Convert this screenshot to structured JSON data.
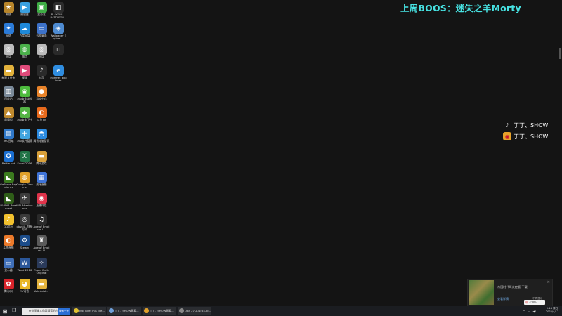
{
  "stream": {
    "title": "上周BOOS：迷失之羊Morty",
    "title_color": "#47e3e3",
    "socials": [
      {
        "icon": "tiktok-icon",
        "label": "丁丁、SHOW"
      },
      {
        "icon": "weibo-icon",
        "label": "丁丁、SHOW"
      }
    ]
  },
  "desktop_icons": [
    {
      "label": "系统",
      "icon": "logo-icon",
      "color": "#b8862b"
    },
    {
      "label": "播放器",
      "icon": "play-icon",
      "color": "#3aa0e0"
    },
    {
      "label": "爱奇艺",
      "icon": "video-icon",
      "color": "#3fae46"
    },
    {
      "label": "PLAYERU... BATTLEGR...",
      "icon": "game-icon",
      "color": "#2c2c2c"
    },
    {
      "label": "网络",
      "icon": "bird-icon",
      "color": "#2b7bd8"
    },
    {
      "label": "百度网盘",
      "icon": "cloud-icon",
      "color": "#1e88d8"
    },
    {
      "label": "远程桌面",
      "icon": "monitor-icon",
      "color": "#3d72c9"
    },
    {
      "label": "Wallpaper Engine: ...",
      "icon": "wallpaper-icon",
      "color": "#4e8bd1"
    },
    {
      "label": "光盘",
      "icon": "disc-icon",
      "color": "#bbbbbb"
    },
    {
      "label": "微信",
      "icon": "wechat-icon",
      "color": "#4ab04a"
    },
    {
      "label": "光盘",
      "icon": "disc-icon",
      "color": "#bbbbbb"
    },
    {
      "label": "",
      "icon": "file-icon",
      "color": "#2a2a2a"
    },
    {
      "label": "新建文件夹",
      "icon": "folder-icon",
      "color": "#e3b23c"
    },
    {
      "label": "视频",
      "icon": "media-icon",
      "color": "#e04a7a"
    },
    {
      "label": "抖音",
      "icon": "music-icon",
      "color": "#2a2a2a"
    },
    {
      "label": "Internet Explorer",
      "icon": "ie-icon",
      "color": "#2f8de0"
    },
    {
      "label": "回收站",
      "icon": "bin-icon",
      "color": "#7a8a99"
    },
    {
      "label": "360安全浏览器",
      "icon": "browser-icon",
      "color": "#4dbb3d"
    },
    {
      "label": "游戏中心",
      "icon": "circle-icon",
      "color": "#e8832a"
    },
    {
      "label": "",
      "icon": "",
      "color": ""
    },
    {
      "label": "屏幕锁",
      "icon": "lock-icon",
      "color": "#c08a2e"
    },
    {
      "label": "360安全卫士",
      "icon": "shield-icon",
      "color": "#55b545"
    },
    {
      "label": "斗鱼TV",
      "icon": "fish-icon",
      "color": "#e86a1c"
    },
    {
      "label": "",
      "icon": "",
      "color": ""
    },
    {
      "label": "360压缩",
      "icon": "zip-icon",
      "color": "#2f78c9"
    },
    {
      "label": "360软件管家",
      "icon": "apps-icon",
      "color": "#41a5e0"
    },
    {
      "label": "腾讯电脑管家",
      "icon": "guard-icon",
      "color": "#2a8ae0"
    },
    {
      "label": "",
      "icon": "",
      "color": ""
    },
    {
      "label": "Battle.net",
      "icon": "battlenet-icon",
      "color": "#1a6ed0"
    },
    {
      "label": "Excel 2016",
      "icon": "excel-icon",
      "color": "#217346"
    },
    {
      "label": "腾讯游戏",
      "icon": "folder-icon",
      "color": "#d8a03a"
    },
    {
      "label": "",
      "icon": "",
      "color": ""
    },
    {
      "label": "GeForce Experience",
      "icon": "nvidia-icon",
      "color": "#3b7a1e"
    },
    {
      "label": "Google Chrome",
      "icon": "chrome-icon",
      "color": "#e0a02a"
    },
    {
      "label": "虎牙直播",
      "icon": "tv-icon",
      "color": "#3f74d8"
    },
    {
      "label": "",
      "icon": "",
      "color": ""
    },
    {
      "label": "NVIDIA Broadcast",
      "icon": "nvidia-icon",
      "color": "#2f5e18"
    },
    {
      "label": "MSI Afterburner",
      "icon": "afterburner-icon",
      "color": "#3c3c3c"
    },
    {
      "label": "直播伴侣",
      "icon": "live-icon",
      "color": "#e0334a"
    },
    {
      "label": "",
      "icon": "",
      "color": ""
    },
    {
      "label": "QQ音乐",
      "icon": "music-icon",
      "color": "#f2c12e"
    },
    {
      "label": "obs64 - 快捷方式",
      "icon": "obs-icon",
      "color": "#3a3a3a"
    },
    {
      "label": "Age of Empires I...",
      "icon": "note-icon",
      "color": "#2a2a2a"
    },
    {
      "label": "",
      "icon": "",
      "color": ""
    },
    {
      "label": "斗鱼直播",
      "icon": "fish-icon",
      "color": "#ec7a2a"
    },
    {
      "label": "Steam",
      "icon": "steam-icon",
      "color": "#1b4c8a"
    },
    {
      "label": "Age of Empires III",
      "icon": "aoe-icon",
      "color": "#5a5a5a"
    },
    {
      "label": "",
      "icon": "",
      "color": ""
    },
    {
      "label": "显示器",
      "icon": "monitor-icon",
      "color": "#3f6fb8"
    },
    {
      "label": "Word 2016",
      "icon": "word-icon",
      "color": "#2b579a"
    },
    {
      "label": "Paper Dolls Original",
      "icon": "doll-icon",
      "color": "#2a3a5a"
    },
    {
      "label": "",
      "icon": "",
      "color": ""
    },
    {
      "label": "腾讯QQ",
      "icon": "qq-icon",
      "color": "#d8232a"
    },
    {
      "label": "YY语音",
      "icon": "yy-icon",
      "color": "#e8b628"
    },
    {
      "label": "Administ...",
      "icon": "user-folder-icon",
      "color": "#e3b23c"
    }
  ],
  "notification": {
    "text": "帝国时代II 决定版 下载",
    "link": "查看详情",
    "button": "不再显示"
  },
  "taskbar": {
    "search_placeholder": "在这里输入你要搜索的内容",
    "search_button": "搜索一下",
    "tasks": [
      {
        "label": "Just Like This (Be...",
        "icon": "emoji-icon",
        "color": "#e0c030"
      },
      {
        "label": "丁丁、SHOW观看...",
        "icon": "browser-icon",
        "color": "#6f9fd8"
      },
      {
        "label": "丁丁、SHOW观看...",
        "icon": "chrome-icon",
        "color": "#e0a02a"
      },
      {
        "label": "OBS 27.2.4 (64-bi...",
        "icon": "obs-icon",
        "color": "#888"
      }
    ],
    "ime": "中",
    "clock_time": "9:14 周日",
    "clock_date": "2022/4/17"
  }
}
